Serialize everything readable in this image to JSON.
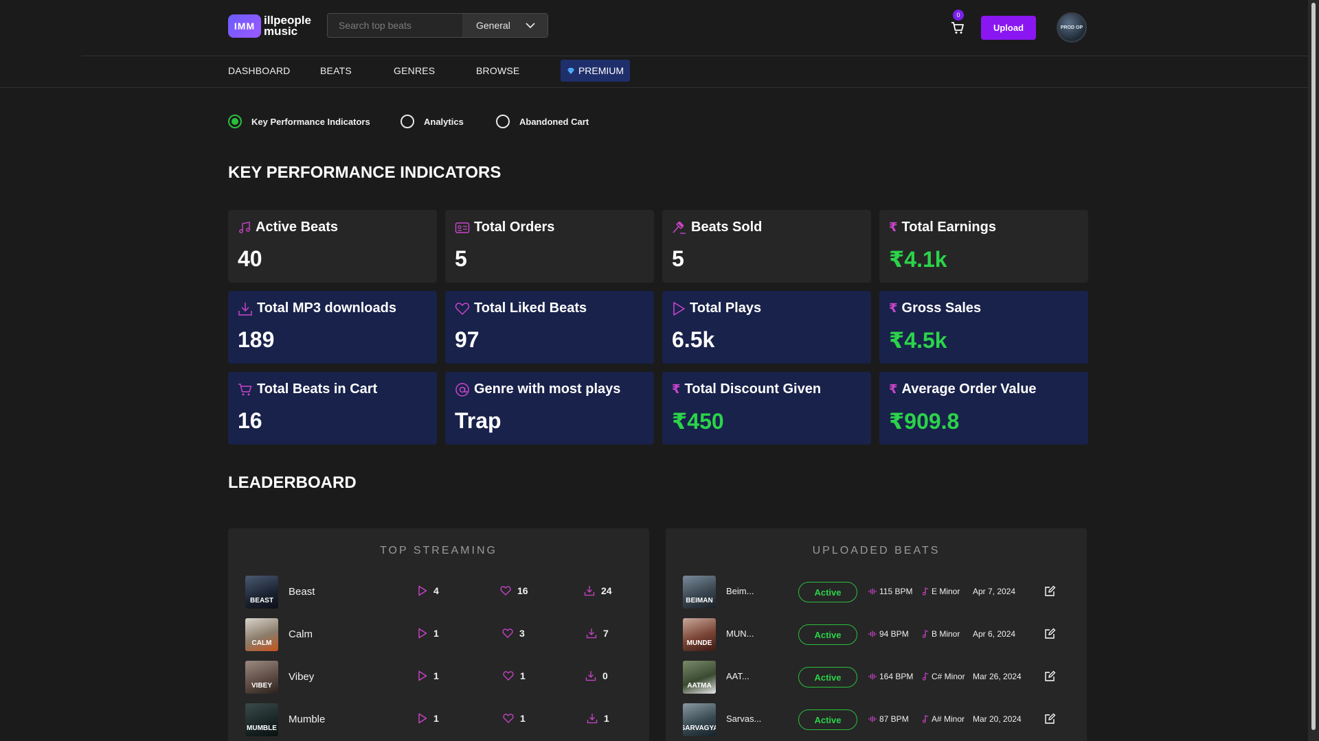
{
  "app": {
    "logo_mark": "IMM",
    "logo_line1": "illpeople",
    "logo_line2": "music"
  },
  "header": {
    "search_placeholder": "Search top beats",
    "search_scope": "General",
    "cart_count": "0",
    "upload_label": "Upload",
    "avatar_label": "PROD OP"
  },
  "nav": {
    "dashboard": "DASHBOARD",
    "beats": "BEATS",
    "genres": "GENRES",
    "browse": "BROWSE",
    "premium": "PREMIUM"
  },
  "tabs": {
    "kpi": "Key Performance Indicators",
    "analytics": "Analytics",
    "abandoned": "Abandoned Cart",
    "selected": "Key Performance Indicators"
  },
  "kpi_section": {
    "title": "KEY PERFORMANCE INDICATORS",
    "cards": [
      {
        "label": "Active Beats",
        "value": "40",
        "icon": "music-note-icon"
      },
      {
        "label": "Total Orders",
        "value": "5",
        "icon": "id-card-icon"
      },
      {
        "label": "Beats Sold",
        "value": "5",
        "icon": "gavel-icon"
      },
      {
        "label": "Total Earnings",
        "value": "₹4.1k",
        "icon": "rupee-icon"
      },
      {
        "label": "Total MP3 downloads",
        "value": "189",
        "icon": "download-icon"
      },
      {
        "label": "Total Liked Beats",
        "value": "97",
        "icon": "heart-icon"
      },
      {
        "label": "Total Plays",
        "value": "6.5k",
        "icon": "play-icon"
      },
      {
        "label": "Gross Sales",
        "value": "₹4.5k",
        "icon": "rupee-icon"
      },
      {
        "label": "Total Beats in Cart",
        "value": "16",
        "icon": "cart-icon"
      },
      {
        "label": "Genre with most plays",
        "value": "Trap",
        "icon": "at-icon"
      },
      {
        "label": "Total Discount Given",
        "value": "₹450",
        "icon": "rupee-icon"
      },
      {
        "label": "Average Order Value",
        "value": "₹909.8",
        "icon": "rupee-icon"
      }
    ]
  },
  "leaderboard": {
    "title": "LEADERBOARD",
    "top_streaming": {
      "title": "TOP STREAMING",
      "rows": [
        {
          "name": "Beast",
          "plays": "4",
          "likes": "16",
          "downloads": "24",
          "cover_text": "BEAST"
        },
        {
          "name": "Calm",
          "plays": "1",
          "likes": "3",
          "downloads": "7",
          "cover_text": "CALM"
        },
        {
          "name": "Vibey",
          "plays": "1",
          "likes": "1",
          "downloads": "0",
          "cover_text": "VIBEY"
        },
        {
          "name": "Mumble",
          "plays": "1",
          "likes": "1",
          "downloads": "1",
          "cover_text": "MUMBLE"
        }
      ]
    },
    "uploaded_beats": {
      "title": "UPLOADED BEATS",
      "rows": [
        {
          "name": "Beim...",
          "status": "Active",
          "bpm": "115 BPM",
          "key": "E Minor",
          "date": "Apr 7, 2024",
          "cover_text": "BEIMAN"
        },
        {
          "name": "MUN...",
          "status": "Active",
          "bpm": "94 BPM",
          "key": "B Minor",
          "date": "Apr 6, 2024",
          "cover_text": "MUNDE"
        },
        {
          "name": "AAT...",
          "status": "Active",
          "bpm": "164 BPM",
          "key": "C# Minor",
          "date": "Mar 26, 2024",
          "cover_text": "AATMA"
        },
        {
          "name": "Sarvas...",
          "status": "Active",
          "bpm": "87 BPM",
          "key": "A# Minor",
          "date": "Mar 20, 2024",
          "cover_text": "SARVAGYA"
        }
      ]
    }
  },
  "colors": {
    "accent_purple": "#8a17f2",
    "positive_green": "#2bd34a",
    "card_blue": "#19224a",
    "card_gray": "#262626",
    "icon_magenta": "#cc44cc"
  }
}
